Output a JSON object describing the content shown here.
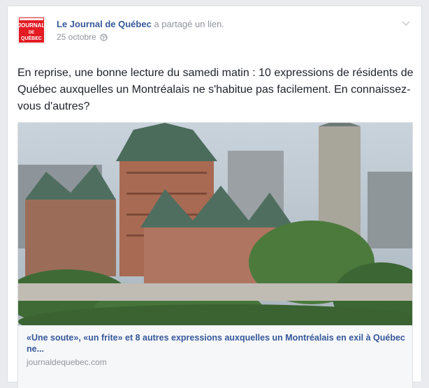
{
  "post": {
    "author": "Le Journal de Québec",
    "action": "a partagé un lien.",
    "date": "25 octobre",
    "text": "En reprise, une bonne lecture du samedi matin : 10 expressions de résidents de Québec auxquelles un Montréalais ne s'habitue pas facilement. En connaissez-vous d'autres?"
  },
  "logo": {
    "line1": "JOURNAL",
    "line2": "DE",
    "line3": "QUÉBEC"
  },
  "link": {
    "title": "«Une soute», «un frite» et 8 autres expressions auxquelles un Montréalais en exil à Québec ne...",
    "domain": "journaldequebec.com"
  },
  "colors": {
    "author_link": "#365899",
    "brand_red": "#e41b23",
    "meta_gray": "#90949c"
  },
  "icons": {
    "privacy": "globe-icon",
    "menu": "chevron-down-icon"
  }
}
